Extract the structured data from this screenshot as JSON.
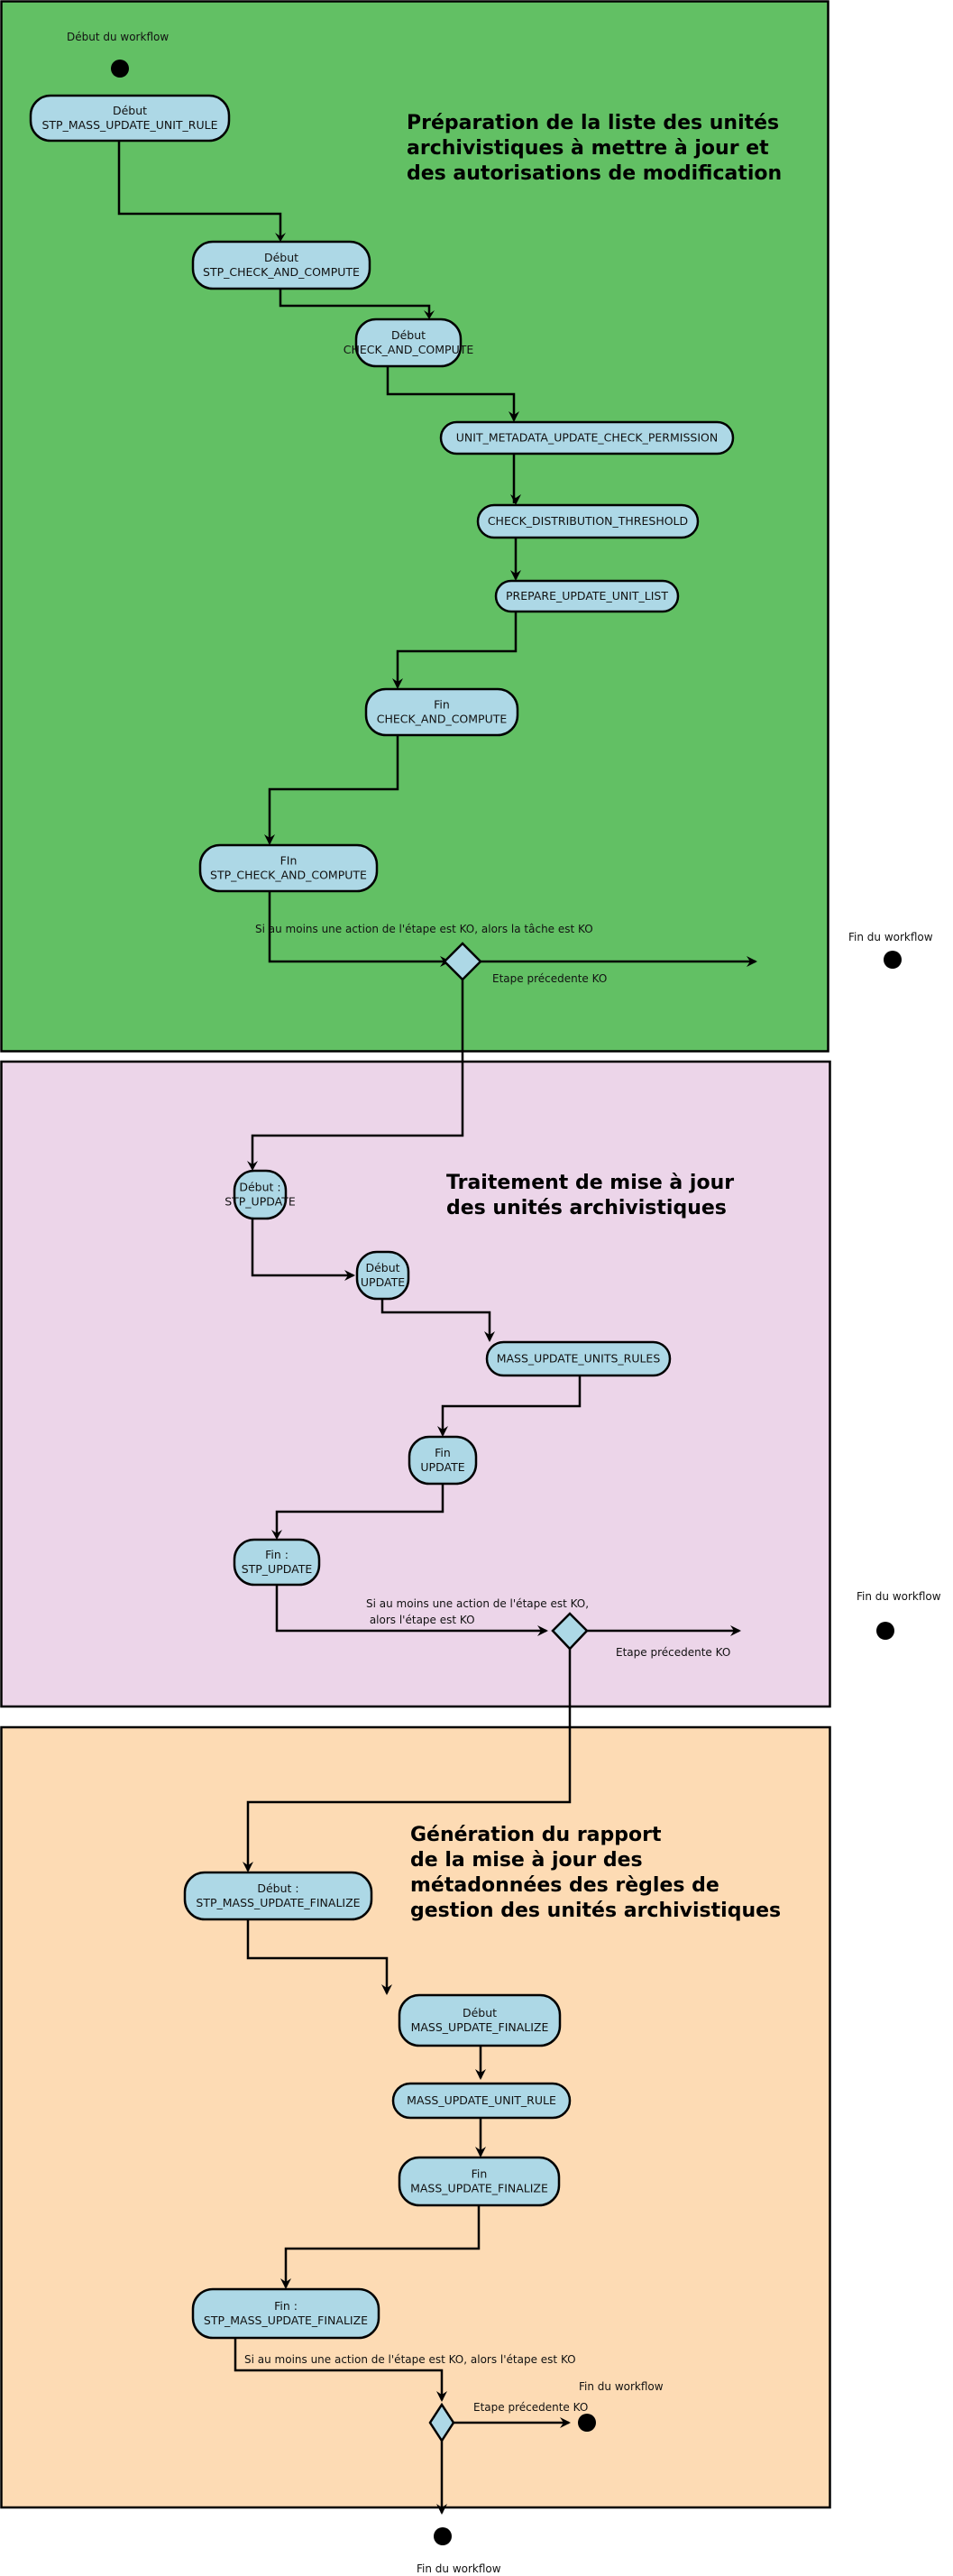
{
  "colors": {
    "lane_preparation": "#62c064",
    "lane_update": "#ecd5e9",
    "lane_report": "#fddbb4",
    "node_fill": "#add8e6",
    "stroke": "#000000"
  },
  "lanes": [
    {
      "id": "preparation",
      "title_lines": [
        "Préparation de la liste des unités",
        "archivistiques à mettre à jour et",
        "des autorisations de modification"
      ]
    },
    {
      "id": "update",
      "title_lines": [
        "Traitement de mise à jour",
        "des unités archivistiques"
      ]
    },
    {
      "id": "report",
      "title_lines": [
        "Génération du rapport",
        "de la mise à jour des",
        "métadonnées des règles de",
        "gestion des unités archivistiques"
      ]
    }
  ],
  "start": {
    "label": "Début du workflow"
  },
  "nodes": [
    {
      "id": "n1",
      "lines": [
        "Début",
        "STP_MASS_UPDATE_UNIT_RULE"
      ]
    },
    {
      "id": "n2",
      "lines": [
        "Début",
        "STP_CHECK_AND_COMPUTE"
      ]
    },
    {
      "id": "n3",
      "lines": [
        "Début",
        "CHECK_AND_COMPUTE"
      ]
    },
    {
      "id": "n4",
      "lines": [
        "UNIT_METADATA_UPDATE_CHECK_PERMISSION"
      ]
    },
    {
      "id": "n5",
      "lines": [
        "CHECK_DISTRIBUTION_THRESHOLD"
      ]
    },
    {
      "id": "n6",
      "lines": [
        "PREPARE_UPDATE_UNIT_LIST"
      ]
    },
    {
      "id": "n7",
      "lines": [
        "Fin",
        "CHECK_AND_COMPUTE"
      ]
    },
    {
      "id": "n8",
      "lines": [
        "FIn",
        "STP_CHECK_AND_COMPUTE"
      ]
    },
    {
      "id": "n9",
      "lines": [
        "Début :",
        "STP_UPDATE"
      ]
    },
    {
      "id": "n10",
      "lines": [
        "Début",
        "UPDATE"
      ]
    },
    {
      "id": "n11",
      "lines": [
        "MASS_UPDATE_UNITS_RULES"
      ]
    },
    {
      "id": "n12",
      "lines": [
        "Fin",
        "UPDATE"
      ]
    },
    {
      "id": "n13",
      "lines": [
        "Fin :",
        "STP_UPDATE"
      ]
    },
    {
      "id": "n14",
      "lines": [
        "Début :",
        "STP_MASS_UPDATE_FINALIZE"
      ]
    },
    {
      "id": "n15",
      "lines": [
        "Début",
        "MASS_UPDATE_FINALIZE"
      ]
    },
    {
      "id": "n16",
      "lines": [
        "MASS_UPDATE_UNIT_RULE"
      ]
    },
    {
      "id": "n17",
      "lines": [
        "Fin",
        "MASS_UPDATE_FINALIZE"
      ]
    },
    {
      "id": "n18",
      "lines": [
        "Fin :",
        "STP_MASS_UPDATE_FINALIZE"
      ]
    }
  ],
  "decisions": [
    {
      "id": "d1",
      "condition_lines": [
        "Si au moins une action de l'étape est KO, alors la tâche est KO"
      ],
      "ko_label": "Etape précedente KO",
      "end_label": "Fin du workflow"
    },
    {
      "id": "d2",
      "condition_lines": [
        "Si au moins une action de l'étape est KO,",
        " alors l'étape est KO"
      ],
      "ko_label": "Etape précedente KO",
      "end_label": "Fin du workflow"
    },
    {
      "id": "d3",
      "condition_lines": [
        "Si au moins une action de l'étape est KO, alors l'étape est KO"
      ],
      "ko_label": "Etape précedente KO",
      "end_label": "Fin du workflow",
      "final_end_label": "Fin du workflow"
    }
  ]
}
